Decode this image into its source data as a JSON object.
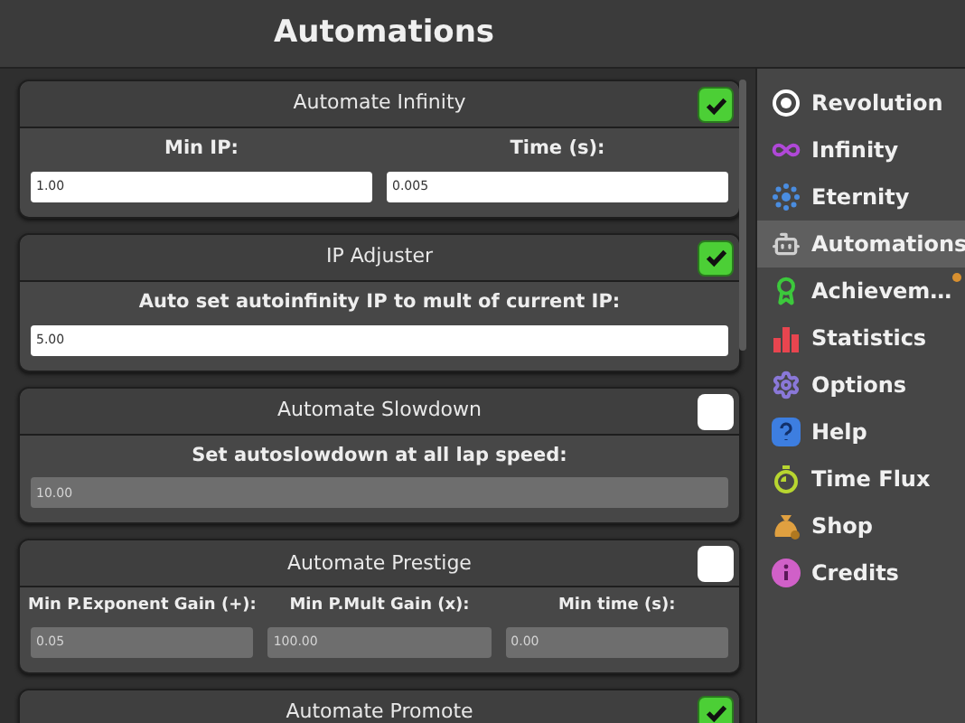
{
  "header": {
    "title": "Automations"
  },
  "cards": [
    {
      "title": "Automate Infinity",
      "checked": true,
      "fields": [
        {
          "label": "Min IP:",
          "value": "1.00"
        },
        {
          "label": "Time (s):",
          "value": "0.005"
        }
      ]
    },
    {
      "title": "IP Adjuster",
      "checked": true,
      "fields": [
        {
          "label": "Auto set autoinfinity IP to mult of current IP:",
          "value": "5.00"
        }
      ]
    },
    {
      "title": "Automate Slowdown",
      "checked": false,
      "fields": [
        {
          "label": "Set autoslowdown at all lap speed:",
          "value": "10.00"
        }
      ]
    },
    {
      "title": "Automate Prestige",
      "checked": false,
      "fields": [
        {
          "label": "Min P.Exponent Gain (+):",
          "value": "0.05"
        },
        {
          "label": "Min P.Mult Gain (x):",
          "value": "100.00"
        },
        {
          "label": "Min time (s):",
          "value": "0.00"
        }
      ]
    },
    {
      "title": "Automate Promote",
      "checked": true
    }
  ],
  "sidebar": {
    "items": [
      {
        "label": "Revolution",
        "selected": false,
        "badge": false
      },
      {
        "label": "Infinity",
        "selected": false,
        "badge": false
      },
      {
        "label": "Eternity",
        "selected": false,
        "badge": false
      },
      {
        "label": "Automations",
        "selected": true,
        "badge": false
      },
      {
        "label": "Achievem…",
        "selected": false,
        "badge": true
      },
      {
        "label": "Statistics",
        "selected": false,
        "badge": false
      },
      {
        "label": "Options",
        "selected": false,
        "badge": false
      },
      {
        "label": "Help",
        "selected": false,
        "badge": false
      },
      {
        "label": "Time Flux",
        "selected": false,
        "badge": false
      },
      {
        "label": "Shop",
        "selected": false,
        "badge": false
      },
      {
        "label": "Credits",
        "selected": false,
        "badge": false
      }
    ]
  }
}
